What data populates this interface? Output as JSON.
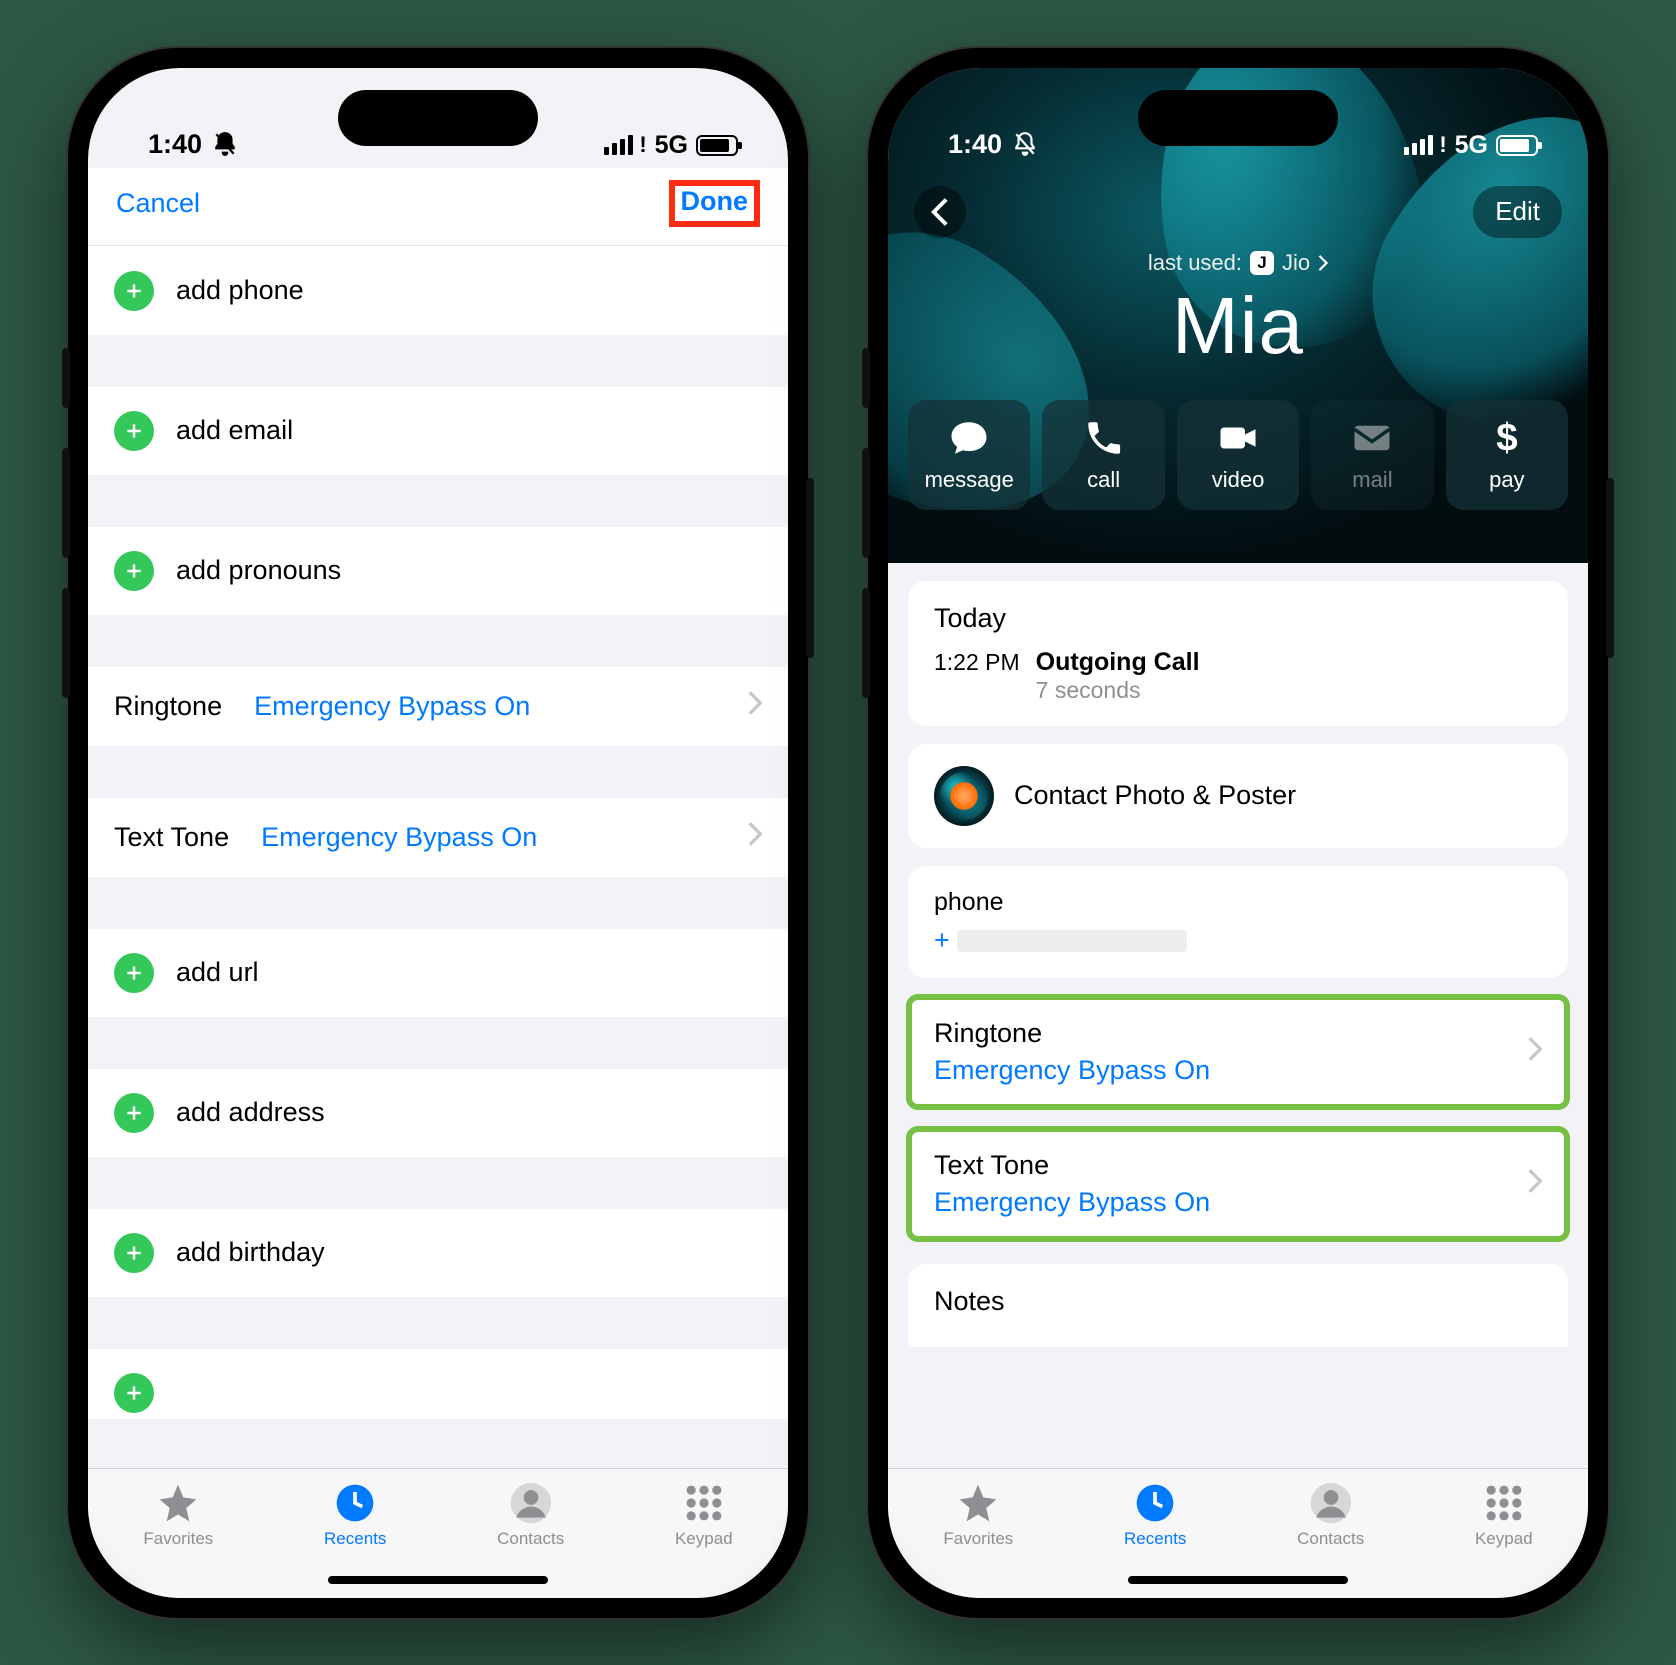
{
  "status": {
    "time": "1:40",
    "network": "5G"
  },
  "left": {
    "cancel": "Cancel",
    "done": "Done",
    "add_phone": "add phone",
    "add_email": "add email",
    "add_pronouns": "add pronouns",
    "ringtone_label": "Ringtone",
    "ringtone_value": "Emergency Bypass On",
    "texttone_label": "Text Tone",
    "texttone_value": "Emergency Bypass On",
    "add_url": "add url",
    "add_address": "add address",
    "add_birthday": "add birthday"
  },
  "right": {
    "edit": "Edit",
    "last_used_prefix": "last used:",
    "last_used_carrier": "Jio",
    "last_used_badge": "J",
    "name": "Mia",
    "actions": {
      "message": "message",
      "call": "call",
      "video": "video",
      "mail": "mail",
      "pay": "pay"
    },
    "today": "Today",
    "call_time": "1:22 PM",
    "call_kind": "Outgoing Call",
    "call_dur": "7 seconds",
    "photo_poster": "Contact Photo & Poster",
    "phone_label": "phone",
    "phone_prefix": "+",
    "ringtone_label": "Ringtone",
    "ringtone_value": "Emergency Bypass On",
    "texttone_label": "Text Tone",
    "texttone_value": "Emergency Bypass On",
    "notes": "Notes"
  },
  "tabs": {
    "favorites": "Favorites",
    "recents": "Recents",
    "contacts": "Contacts",
    "keypad": "Keypad"
  }
}
